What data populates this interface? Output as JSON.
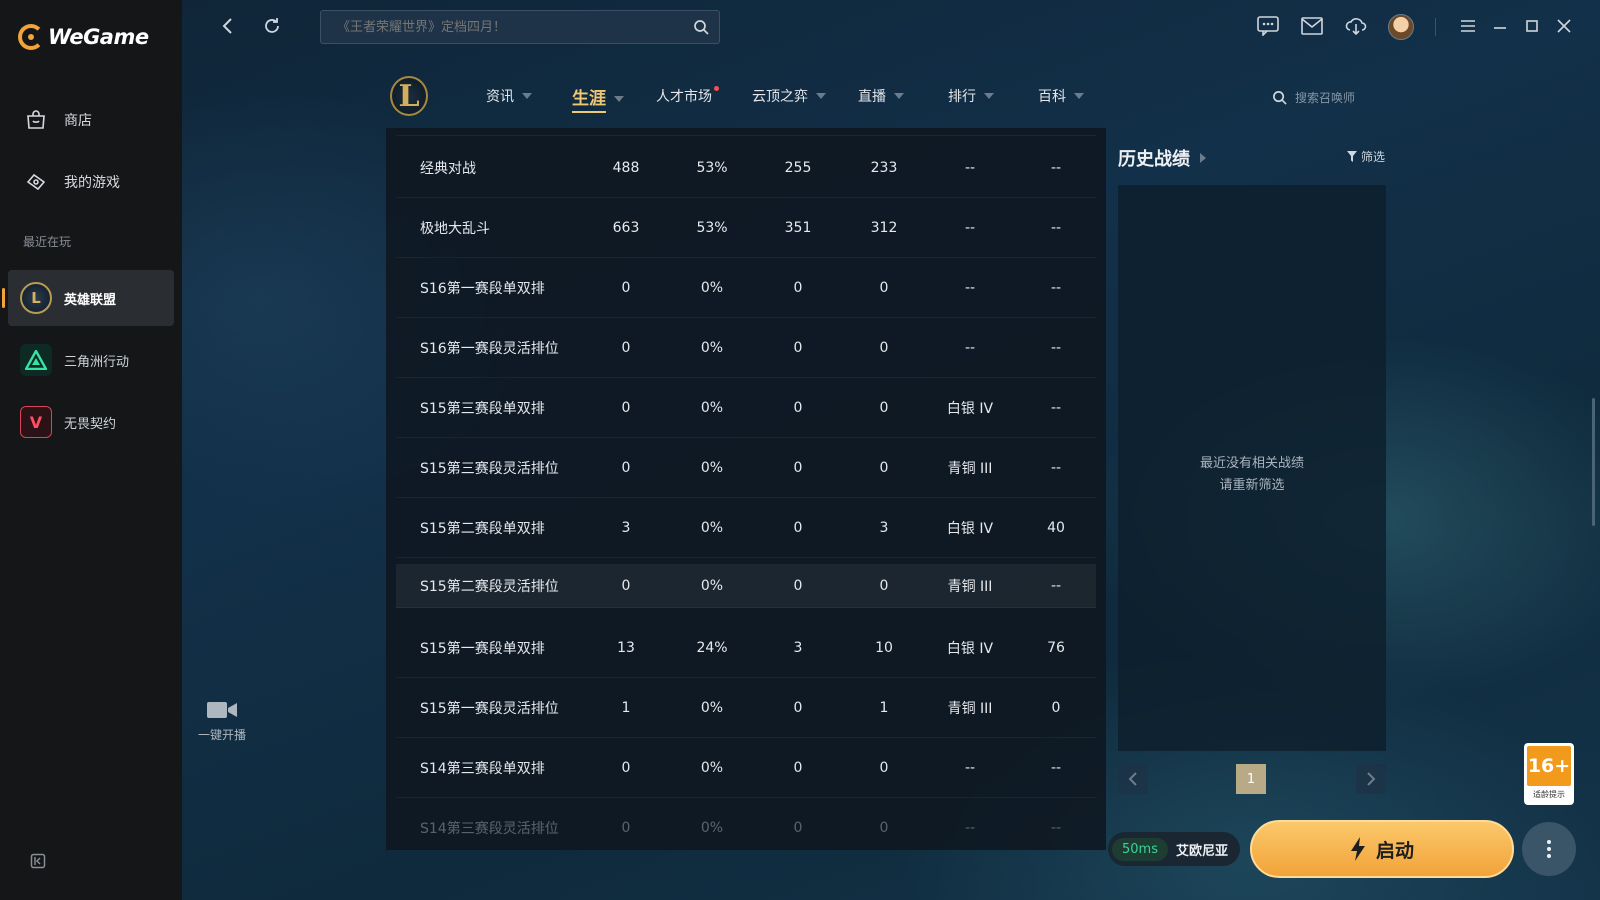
{
  "app": {
    "name": "WeGame"
  },
  "sidebar": {
    "items": [
      {
        "label": "商店",
        "icon": "store-icon"
      },
      {
        "label": "我的游戏",
        "icon": "gamepad-icon"
      }
    ],
    "recent_label": "最近在玩",
    "games": [
      {
        "label": "英雄联盟",
        "icon": "lol-icon",
        "active": true
      },
      {
        "label": "三角洲行动",
        "icon": "delta-force-icon",
        "active": false
      },
      {
        "label": "无畏契约",
        "icon": "valorant-icon",
        "active": false
      }
    ]
  },
  "topbar": {
    "search_placeholder": "《王者荣耀世界》定档四月！"
  },
  "game_nav": {
    "items": [
      {
        "label": "资讯",
        "dropdown": true
      },
      {
        "label": "生涯",
        "dropdown": true,
        "active": true
      },
      {
        "label": "人才市场",
        "dropdown": false,
        "badge": true
      },
      {
        "label": "云顶之弈",
        "dropdown": true
      },
      {
        "label": "直播",
        "dropdown": true
      },
      {
        "label": "排行",
        "dropdown": true
      },
      {
        "label": "百科",
        "dropdown": true
      }
    ],
    "summoner_search_placeholder": "搜索召唤师"
  },
  "stats_table": {
    "rows": [
      {
        "mode": "经典对战",
        "games": "488",
        "winrate": "53%",
        "wins": "255",
        "losses": "233",
        "rank": "--",
        "points": "--"
      },
      {
        "mode": "极地大乱斗",
        "games": "663",
        "winrate": "53%",
        "wins": "351",
        "losses": "312",
        "rank": "--",
        "points": "--"
      },
      {
        "mode": "S16第一赛段单双排",
        "games": "0",
        "winrate": "0%",
        "wins": "0",
        "losses": "0",
        "rank": "--",
        "points": "--"
      },
      {
        "mode": "S16第一赛段灵活排位",
        "games": "0",
        "winrate": "0%",
        "wins": "0",
        "losses": "0",
        "rank": "--",
        "points": "--"
      },
      {
        "mode": "S15第三赛段单双排",
        "games": "0",
        "winrate": "0%",
        "wins": "0",
        "losses": "0",
        "rank": "白银 IV",
        "points": "--"
      },
      {
        "mode": "S15第三赛段灵活排位",
        "games": "0",
        "winrate": "0%",
        "wins": "0",
        "losses": "0",
        "rank": "青铜 III",
        "points": "--"
      },
      {
        "mode": "S15第二赛段单双排",
        "games": "3",
        "winrate": "0%",
        "wins": "0",
        "losses": "3",
        "rank": "白银 IV",
        "points": "40"
      },
      {
        "mode": "S15第二赛段灵活排位",
        "games": "0",
        "winrate": "0%",
        "wins": "0",
        "losses": "0",
        "rank": "青铜 III",
        "points": "--"
      },
      {
        "mode": "S15第一赛段单双排",
        "games": "13",
        "winrate": "24%",
        "wins": "3",
        "losses": "10",
        "rank": "白银 IV",
        "points": "76"
      },
      {
        "mode": "S15第一赛段灵活排位",
        "games": "1",
        "winrate": "0%",
        "wins": "0",
        "losses": "1",
        "rank": "青铜 III",
        "points": "0"
      },
      {
        "mode": "S14第三赛段单双排",
        "games": "0",
        "winrate": "0%",
        "wins": "0",
        "losses": "0",
        "rank": "--",
        "points": "--"
      },
      {
        "mode": "S14第三赛段灵活排位",
        "games": "0",
        "winrate": "0%",
        "wins": "0",
        "losses": "0",
        "rank": "--",
        "points": "--"
      }
    ]
  },
  "history": {
    "title": "历史战绩",
    "filter_label": "筛选",
    "empty_line1": "最近没有相关战绩",
    "empty_line2": "请重新筛选",
    "page": "1"
  },
  "live": {
    "label": "一键开播"
  },
  "rating": {
    "age": "16+",
    "caption": "适龄提示"
  },
  "bottom": {
    "ping": "50ms",
    "server": "艾欧尼亚",
    "start_label": "启动"
  },
  "colors": {
    "accent": "#f2a33a",
    "ping_green": "#38d39b",
    "active_nav": "#f0c873"
  }
}
